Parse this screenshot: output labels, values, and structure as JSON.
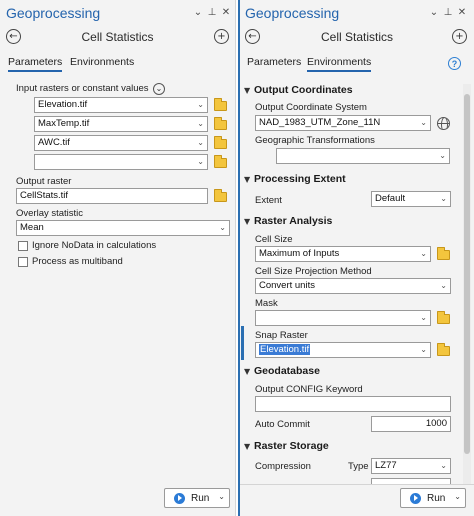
{
  "left": {
    "title": "Geoprocessing",
    "tool_title": "Cell Statistics",
    "tabs": [
      "Parameters",
      "Environments"
    ],
    "input_label": "Input rasters or constant values",
    "inputs": [
      "Elevation.tif",
      "MaxTemp.tif",
      "AWC.tif",
      ""
    ],
    "output_label": "Output raster",
    "output_value": "CellStats.tif",
    "overlay_label": "Overlay statistic",
    "overlay_value": "Mean",
    "ignore_nodata_label": "Ignore NoData in calculations",
    "multiband_label": "Process as multiband",
    "run_label": "Run"
  },
  "right": {
    "title": "Geoprocessing",
    "tool_title": "Cell Statistics",
    "tabs": [
      "Parameters",
      "Environments"
    ],
    "output_coordinates": {
      "header": "Output Coordinates",
      "system_label": "Output Coordinate System",
      "system_value": "NAD_1983_UTM_Zone_11N",
      "geo_transform_label": "Geographic Transformations",
      "geo_transform_value": ""
    },
    "processing_extent": {
      "header": "Processing Extent",
      "extent_label": "Extent",
      "extent_value": "Default"
    },
    "raster_analysis": {
      "header": "Raster Analysis",
      "cell_size_label": "Cell Size",
      "cell_size_value": "Maximum of Inputs",
      "projection_label": "Cell Size Projection Method",
      "projection_value": "Convert units",
      "mask_label": "Mask",
      "mask_value": "",
      "snap_label": "Snap Raster",
      "snap_value": "Elevation.tif"
    },
    "geodatabase": {
      "header": "Geodatabase",
      "config_label": "Output CONFIG Keyword",
      "config_value": "",
      "autocommit_label": "Auto Commit",
      "autocommit_value": "1000"
    },
    "raster_storage": {
      "header": "Raster Storage",
      "compression_label": "Compression",
      "type_label": "Type",
      "type_value": "LZ77"
    },
    "run_label": "Run"
  },
  "glyphs": {
    "dropdown": "⌄",
    "pin": "⊥",
    "close": "✕",
    "back": "←",
    "add": "+",
    "help": "?",
    "chevron": "▼",
    "expand": "⌄"
  }
}
